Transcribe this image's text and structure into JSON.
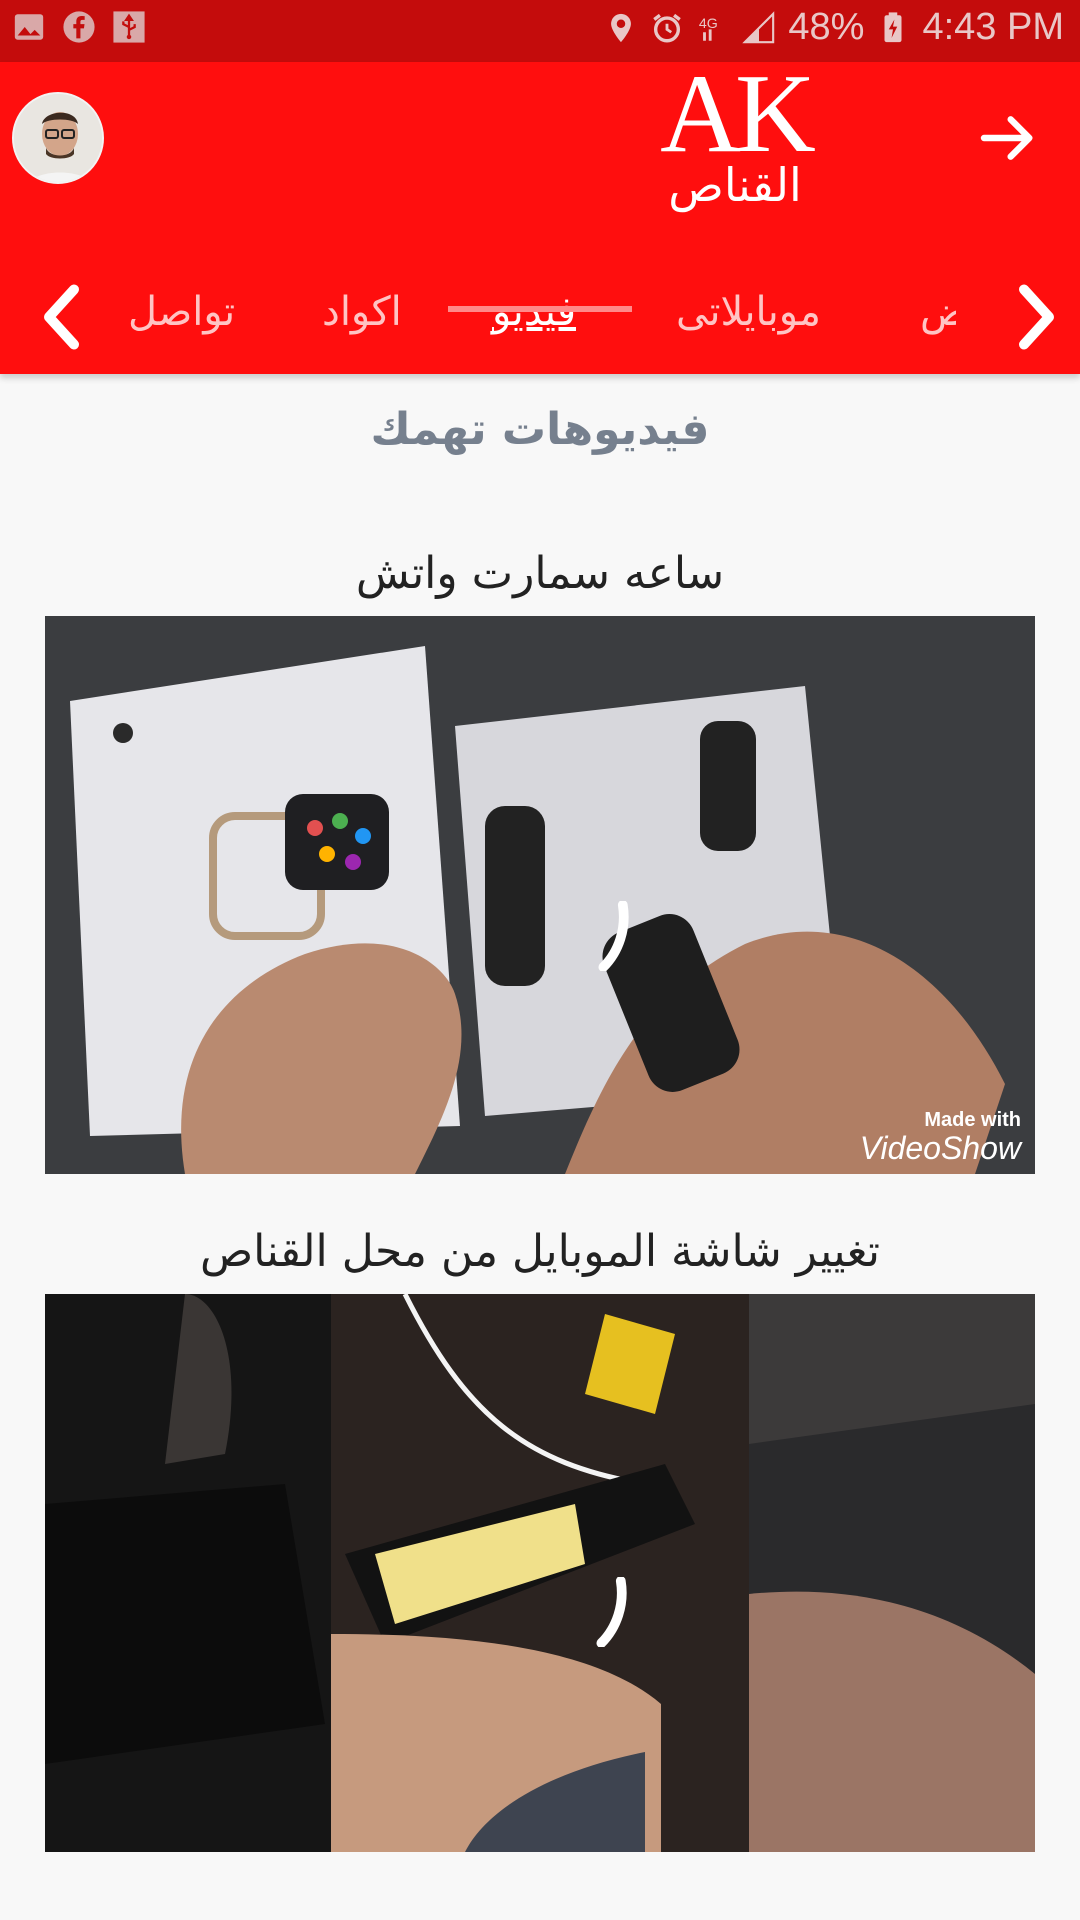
{
  "status_bar": {
    "battery": "48%",
    "time": "4:43 PM",
    "left_icons": [
      "image-icon",
      "facebook-icon",
      "usb-icon"
    ],
    "right_icons": [
      "location-icon",
      "alarm-icon",
      "4g-icon",
      "signal-icon",
      "battery-charging-icon"
    ]
  },
  "header": {
    "logo_text": "AK",
    "logo_subtitle": "القناص",
    "avatar_icon": "avatar",
    "forward_icon": "arrow-right-icon",
    "accent_color": "#ff0e0e"
  },
  "tabs": {
    "items": [
      {
        "label": "تواصل"
      },
      {
        "label": "اكواد"
      },
      {
        "label": "فيديو"
      },
      {
        "label": "موبايلاتى"
      },
      {
        "label": "ض"
      }
    ],
    "active": "فيديو"
  },
  "main": {
    "section_title": "فيديوهات تهمك",
    "videos": [
      {
        "title": "ساعه سمارت واتش",
        "watermark_line1": "Made with",
        "watermark_line2": "VideoShow"
      },
      {
        "title": "تغيير شاشة الموبايل من محل القناص"
      }
    ]
  }
}
